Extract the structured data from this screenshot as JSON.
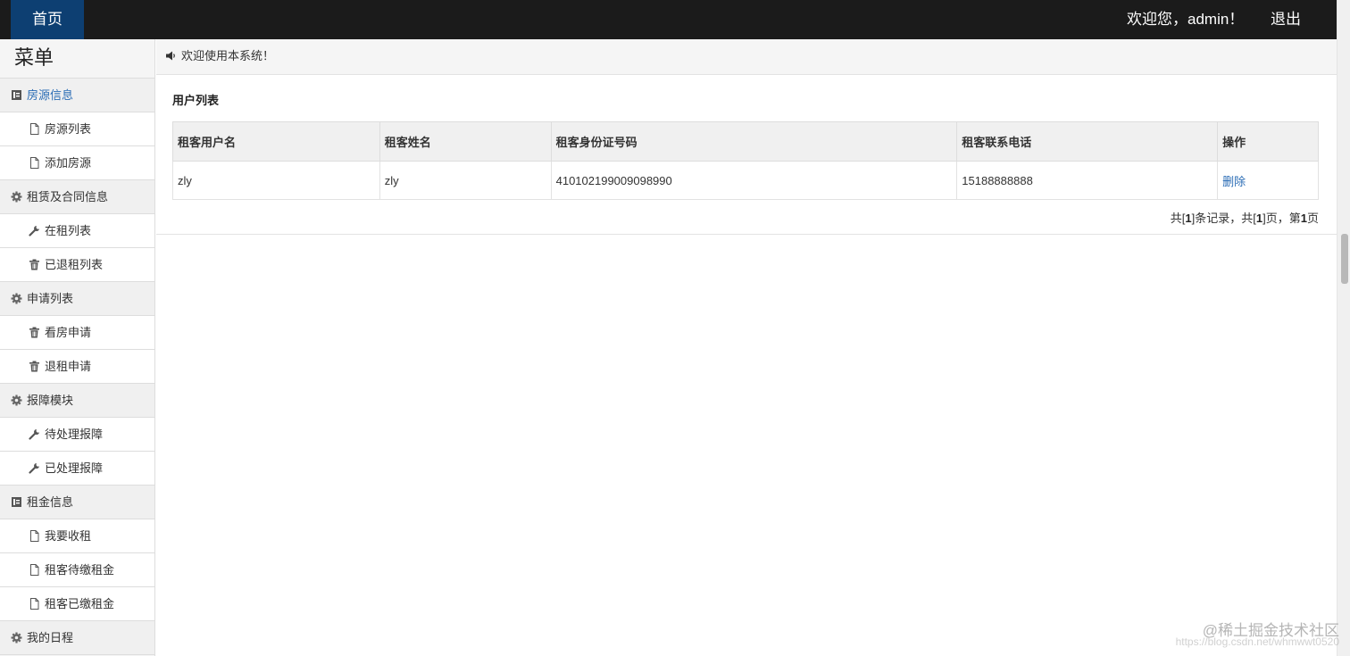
{
  "header": {
    "home_label": "首页",
    "welcome": "欢迎您，admin！",
    "logout_label": "退出"
  },
  "sidebar": {
    "title": "菜单",
    "groups": [
      {
        "label": "房源信息",
        "icon": "book-icon",
        "items": [
          {
            "label": "房源列表",
            "icon": "file-icon"
          },
          {
            "label": "添加房源",
            "icon": "file-icon"
          }
        ]
      },
      {
        "label": "租赁及合同信息",
        "icon": "gear-icon",
        "items": [
          {
            "label": "在租列表",
            "icon": "wrench-icon"
          },
          {
            "label": "已退租列表",
            "icon": "trash-icon"
          }
        ]
      },
      {
        "label": "申请列表",
        "icon": "gear-icon",
        "items": [
          {
            "label": "看房申请",
            "icon": "trash-icon"
          },
          {
            "label": "退租申请",
            "icon": "trash-icon"
          }
        ]
      },
      {
        "label": "报障模块",
        "icon": "gear-icon",
        "items": [
          {
            "label": "待处理报障",
            "icon": "wrench-icon"
          },
          {
            "label": "已处理报障",
            "icon": "wrench-icon"
          }
        ]
      },
      {
        "label": "租金信息",
        "icon": "book-icon",
        "items": [
          {
            "label": "我要收租",
            "icon": "file-icon"
          },
          {
            "label": "租客待缴租金",
            "icon": "file-icon"
          },
          {
            "label": "租客已缴租金",
            "icon": "file-icon"
          }
        ]
      },
      {
        "label": "我的日程",
        "icon": "gear-icon",
        "items": []
      }
    ]
  },
  "main": {
    "notice": "欢迎使用本系统！",
    "panel_title": "用户列表",
    "table": {
      "headers": [
        "租客用户名",
        "租客姓名",
        "租客身份证号码",
        "租客联系电话",
        "操作"
      ],
      "rows": [
        {
          "username": "zly",
          "name": "zly",
          "id_number": "410102199009098990",
          "phone": "15188888888",
          "action": "删除"
        }
      ]
    },
    "pager": {
      "prefix": "共[",
      "total": "1",
      "mid1": "]条记录，共[",
      "pages": "1",
      "mid2": "]页，第",
      "current": "1",
      "suffix": "页"
    }
  },
  "watermark": {
    "line1": "@稀土掘金技术社区",
    "line2": "https://blog.csdn.net/whmwwt0520"
  },
  "colors": {
    "topbar": "#1b1b1b",
    "home_tab": "#0d3f72",
    "link": "#2a6cb5"
  }
}
